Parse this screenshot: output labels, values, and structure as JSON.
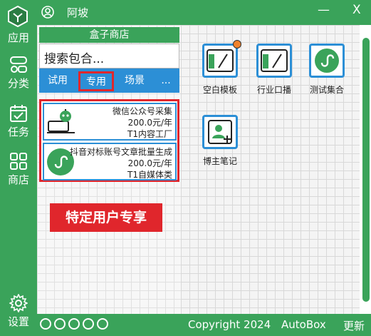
{
  "titlebar": {
    "username": "阿坡",
    "minimize": "—",
    "close": "X"
  },
  "sidebar": {
    "items": [
      {
        "label": "应用"
      },
      {
        "label": "分类"
      },
      {
        "label": "任务"
      },
      {
        "label": "商店"
      }
    ],
    "settings_label": "设置"
  },
  "shop": {
    "title": "盒子商店",
    "search_value": "搜索包合...",
    "tabs": [
      "试用",
      "专用",
      "场景",
      "..."
    ],
    "active_tab": "专用",
    "items": [
      {
        "name": "微信公众号采集",
        "price": "200.0元/年",
        "category": "T1内容工厂"
      },
      {
        "name": "抖音对标账号文章批量生成",
        "price": "200.0元/年",
        "category": "T1自媒体类"
      }
    ],
    "promo": "特定用户专享"
  },
  "apps": [
    {
      "label": "空白模板",
      "icon": "blank-template-icon"
    },
    {
      "label": "行业口播",
      "icon": "industry-broadcast-icon"
    },
    {
      "label": "测试集合",
      "icon": "test-collection-icon"
    },
    {
      "label": "博主笔记",
      "icon": "blogger-notes-icon"
    }
  ],
  "footer": {
    "copyright": "Copyright  2024",
    "brand": "AutoBox",
    "update": "更新"
  },
  "colors": {
    "green": "#3aa35a",
    "blue": "#2c8fd6",
    "red": "#e0262c",
    "orange": "#f0822d"
  }
}
